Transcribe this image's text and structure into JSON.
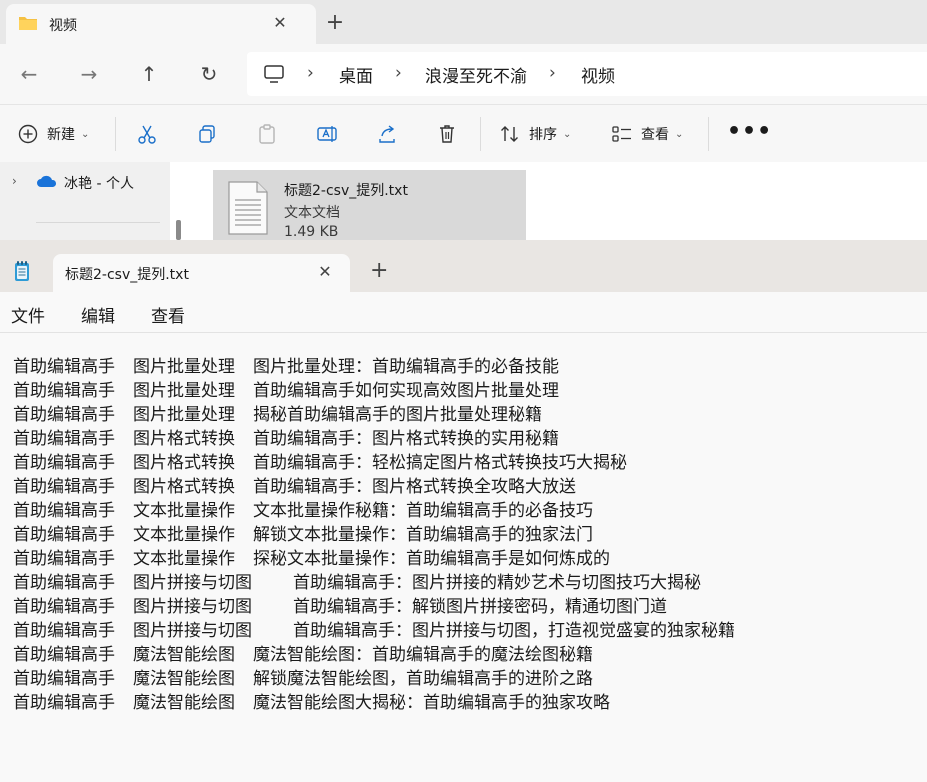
{
  "explorer": {
    "tab_title": "视频",
    "address": {
      "crumbs": [
        "桌面",
        "浪漫至死不渝",
        "视频"
      ]
    },
    "commands": {
      "new_label": "新建",
      "sort_label": "排序",
      "view_label": "查看"
    },
    "navpane": {
      "onedrive_label": "冰艳 - 个人"
    },
    "file": {
      "name": "标题2-csv_提列.txt",
      "type": "文本文档",
      "size": "1.49 KB"
    }
  },
  "notepad": {
    "tab_title": "标题2-csv_提列.txt",
    "menu": [
      "文件",
      "编辑",
      "查看"
    ],
    "lines": [
      [
        "首助编辑高手",
        "图片批量处理",
        "图片批量处理：首助编辑高手的必备技能"
      ],
      [
        "首助编辑高手",
        "图片批量处理",
        "首助编辑高手如何实现高效图片批量处理"
      ],
      [
        "首助编辑高手",
        "图片批量处理",
        "揭秘首助编辑高手的图片批量处理秘籍"
      ],
      [
        "首助编辑高手",
        "图片格式转换",
        "首助编辑高手：图片格式转换的实用秘籍"
      ],
      [
        "首助编辑高手",
        "图片格式转换",
        "首助编辑高手：轻松搞定图片格式转换技巧大揭秘"
      ],
      [
        "首助编辑高手",
        "图片格式转换",
        "首助编辑高手：图片格式转换全攻略大放送"
      ],
      [
        "首助编辑高手",
        "文本批量操作",
        "文本批量操作秘籍：首助编辑高手的必备技巧"
      ],
      [
        "首助编辑高手",
        "文本批量操作",
        "解锁文本批量操作：首助编辑高手的独家法门"
      ],
      [
        "首助编辑高手",
        "文本批量操作",
        "探秘文本批量操作：首助编辑高手是如何炼成的"
      ],
      [
        "首助编辑高手",
        "图片拼接与切图",
        "首助编辑高手：图片拼接的精妙艺术与切图技巧大揭秘"
      ],
      [
        "首助编辑高手",
        "图片拼接与切图",
        "首助编辑高手：解锁图片拼接密码，精通切图门道"
      ],
      [
        "首助编辑高手",
        "图片拼接与切图",
        "首助编辑高手：图片拼接与切图，打造视觉盛宴的独家秘籍"
      ],
      [
        "首助编辑高手",
        "魔法智能绘图",
        "魔法智能绘图：首助编辑高手的魔法绘图秘籍"
      ],
      [
        "首助编辑高手",
        "魔法智能绘图",
        "解锁魔法智能绘图，首助编辑高手的进阶之路"
      ],
      [
        "首助编辑高手",
        "魔法智能绘图",
        "魔法智能绘图大揭秘：首助编辑高手的独家攻略"
      ]
    ]
  }
}
